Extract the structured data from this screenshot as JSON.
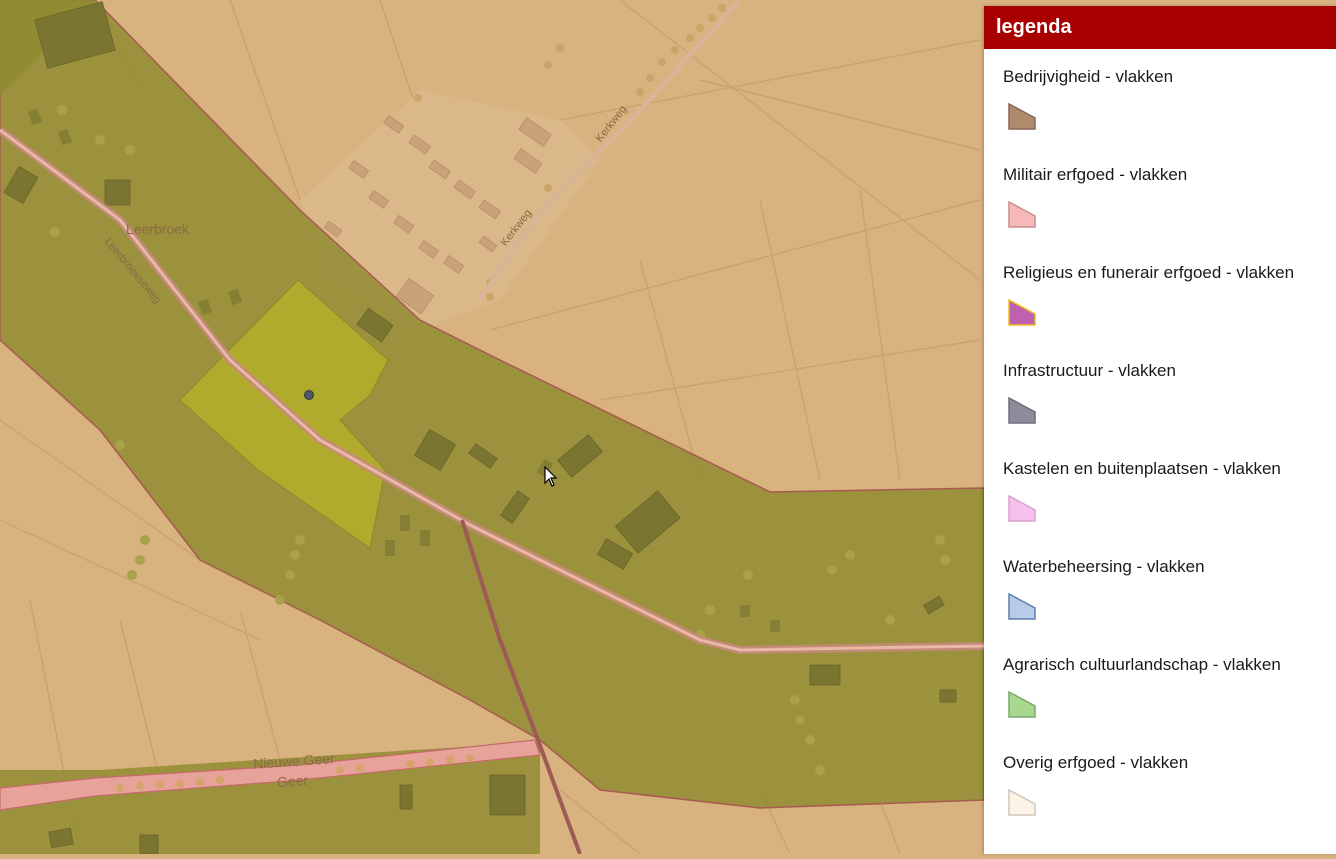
{
  "map": {
    "place_labels": [
      "Leerbroek",
      "Nieuwe Geer",
      "Geer"
    ],
    "street_labels": [
      "Kerkweg",
      "Kerkweg",
      "Leerbroekseweg"
    ]
  },
  "legend": {
    "title": "legenda",
    "items": [
      {
        "label": "Bedrijvigheid - vlakken",
        "fill": "#b08a6e",
        "stroke": "#8a6553"
      },
      {
        "label": "Militair erfgoed - vlakken",
        "fill": "#f7b8b8",
        "stroke": "#c98f8f"
      },
      {
        "label": "Religieus en funerair erfgoed - vlakken",
        "fill": "#c060b0",
        "stroke": "#e8c020"
      },
      {
        "label": "Infrastructuur - vlakken",
        "fill": "#8c8c9a",
        "stroke": "#6e6e7e"
      },
      {
        "label": "Kastelen en buitenplaatsen - vlakken",
        "fill": "#f7c0ec",
        "stroke": "#d9a0d0"
      },
      {
        "label": "Waterbeheersing - vlakken",
        "fill": "#b8cce8",
        "stroke": "#5f7fb0"
      },
      {
        "label": "Agrarisch cultuurlandschap - vlakken",
        "fill": "#a8d890",
        "stroke": "#7aa868"
      },
      {
        "label": "Overig erfgoed - vlakken",
        "fill": "#faf3e6",
        "stroke": "#cfc6b6"
      }
    ]
  },
  "colors": {
    "legend_header": "#a80000",
    "map_background": "#d8b27f",
    "heritage_zone": "#8f8a2e",
    "highlight_zone": "#a9a62a",
    "road": "#c98a7e"
  }
}
